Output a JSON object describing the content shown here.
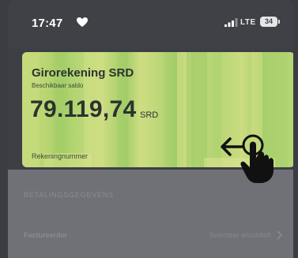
{
  "status_bar": {
    "time": "17:47",
    "network": "LTE",
    "battery": "34"
  },
  "card": {
    "account_name": "Girorekening SRD",
    "balance_label": "Beschikbaar saldo",
    "balance": "79.119,74",
    "currency": "SRD",
    "account_number_label": "Rekeningnummer",
    "accent_color": "#b7d675"
  },
  "payment_section": {
    "header": "BETALINGSGEGEVENS",
    "rows": [
      {
        "label": "Factureerder",
        "value": "Selecteer alstublieft"
      }
    ]
  },
  "icons": [
    "heart-icon",
    "signal-icon",
    "battery-icon",
    "swipe-hand-icon",
    "chevron-right-icon"
  ]
}
